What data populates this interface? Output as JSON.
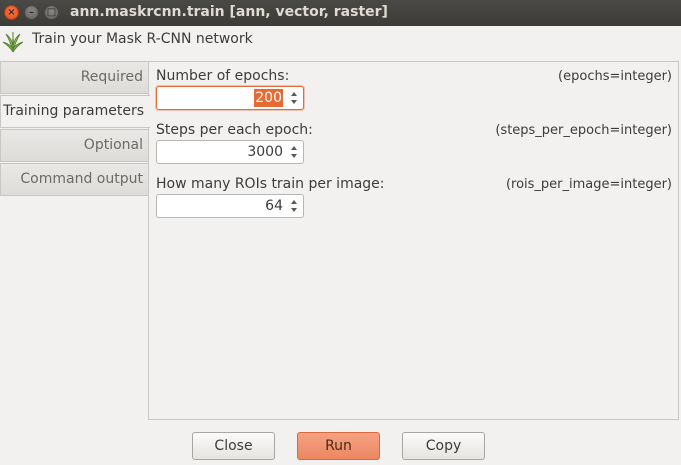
{
  "window": {
    "title": "ann.maskrcnn.train [ann, vector, raster]",
    "close_glyph": "×",
    "minimize_glyph": "–",
    "maximize_glyph": "□"
  },
  "header": {
    "text": "Train your Mask R-CNN network",
    "icon": "grass-logo-icon"
  },
  "tabs": [
    {
      "label": "Required",
      "active": false
    },
    {
      "label": "Training parameters",
      "active": true
    },
    {
      "label": "Optional",
      "active": false
    },
    {
      "label": "Command output",
      "active": false
    }
  ],
  "fields": [
    {
      "label": "Number of epochs:",
      "key": "(epochs=integer)",
      "value": "200",
      "focused": true
    },
    {
      "label": "Steps per each epoch:",
      "key": "(steps_per_epoch=integer)",
      "value": "3000",
      "focused": false
    },
    {
      "label": "How many ROIs train per image:",
      "key": "(rois_per_image=integer)",
      "value": "64",
      "focused": false
    }
  ],
  "buttons": {
    "close": "Close",
    "run": "Run",
    "copy": "Copy"
  },
  "colors": {
    "accent": "#e86a32",
    "titlebar": "#3c3b37",
    "background": "#f2f1f0"
  }
}
